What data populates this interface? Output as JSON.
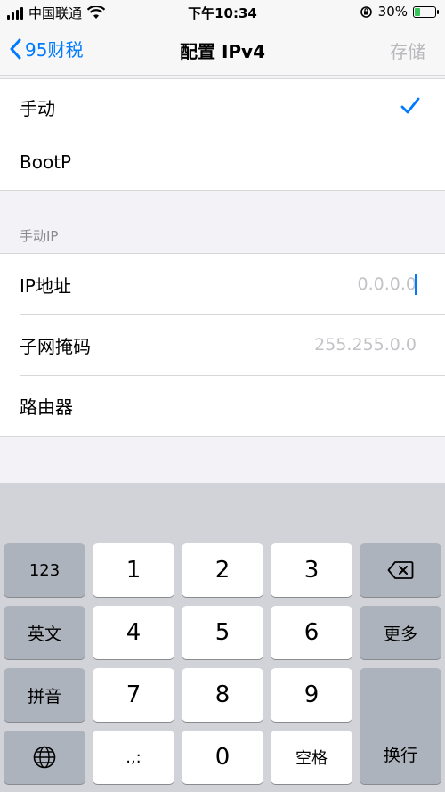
{
  "status_bar": {
    "carrier": "中国联通",
    "time": "下午10:34",
    "battery_percent": "30%",
    "battery_level": 0.3
  },
  "nav": {
    "back_label": "95财税",
    "title": "配置 IPv4",
    "save_label": "存储"
  },
  "mode_options": [
    {
      "label": "手动",
      "selected": true
    },
    {
      "label": "BootP",
      "selected": false
    }
  ],
  "manual_section": {
    "header": "手动IP",
    "fields": [
      {
        "label": "IP地址",
        "placeholder": "0.0.0.0"
      },
      {
        "label": "子网掩码",
        "placeholder": "255.255.0.0"
      },
      {
        "label": "路由器",
        "placeholder": ""
      }
    ]
  },
  "keyboard": {
    "row1": [
      "1",
      "2",
      "3"
    ],
    "row2": [
      "4",
      "5",
      "6"
    ],
    "row3": [
      "7",
      "8",
      "9"
    ],
    "zero": "0",
    "punct": ".,:",
    "space": "空格",
    "mode_123": "123",
    "english": "英文",
    "pinyin": "拼音",
    "more": "更多",
    "return": "换行"
  },
  "colors": {
    "accent": "#007aff",
    "battery_green": "#34c759"
  }
}
